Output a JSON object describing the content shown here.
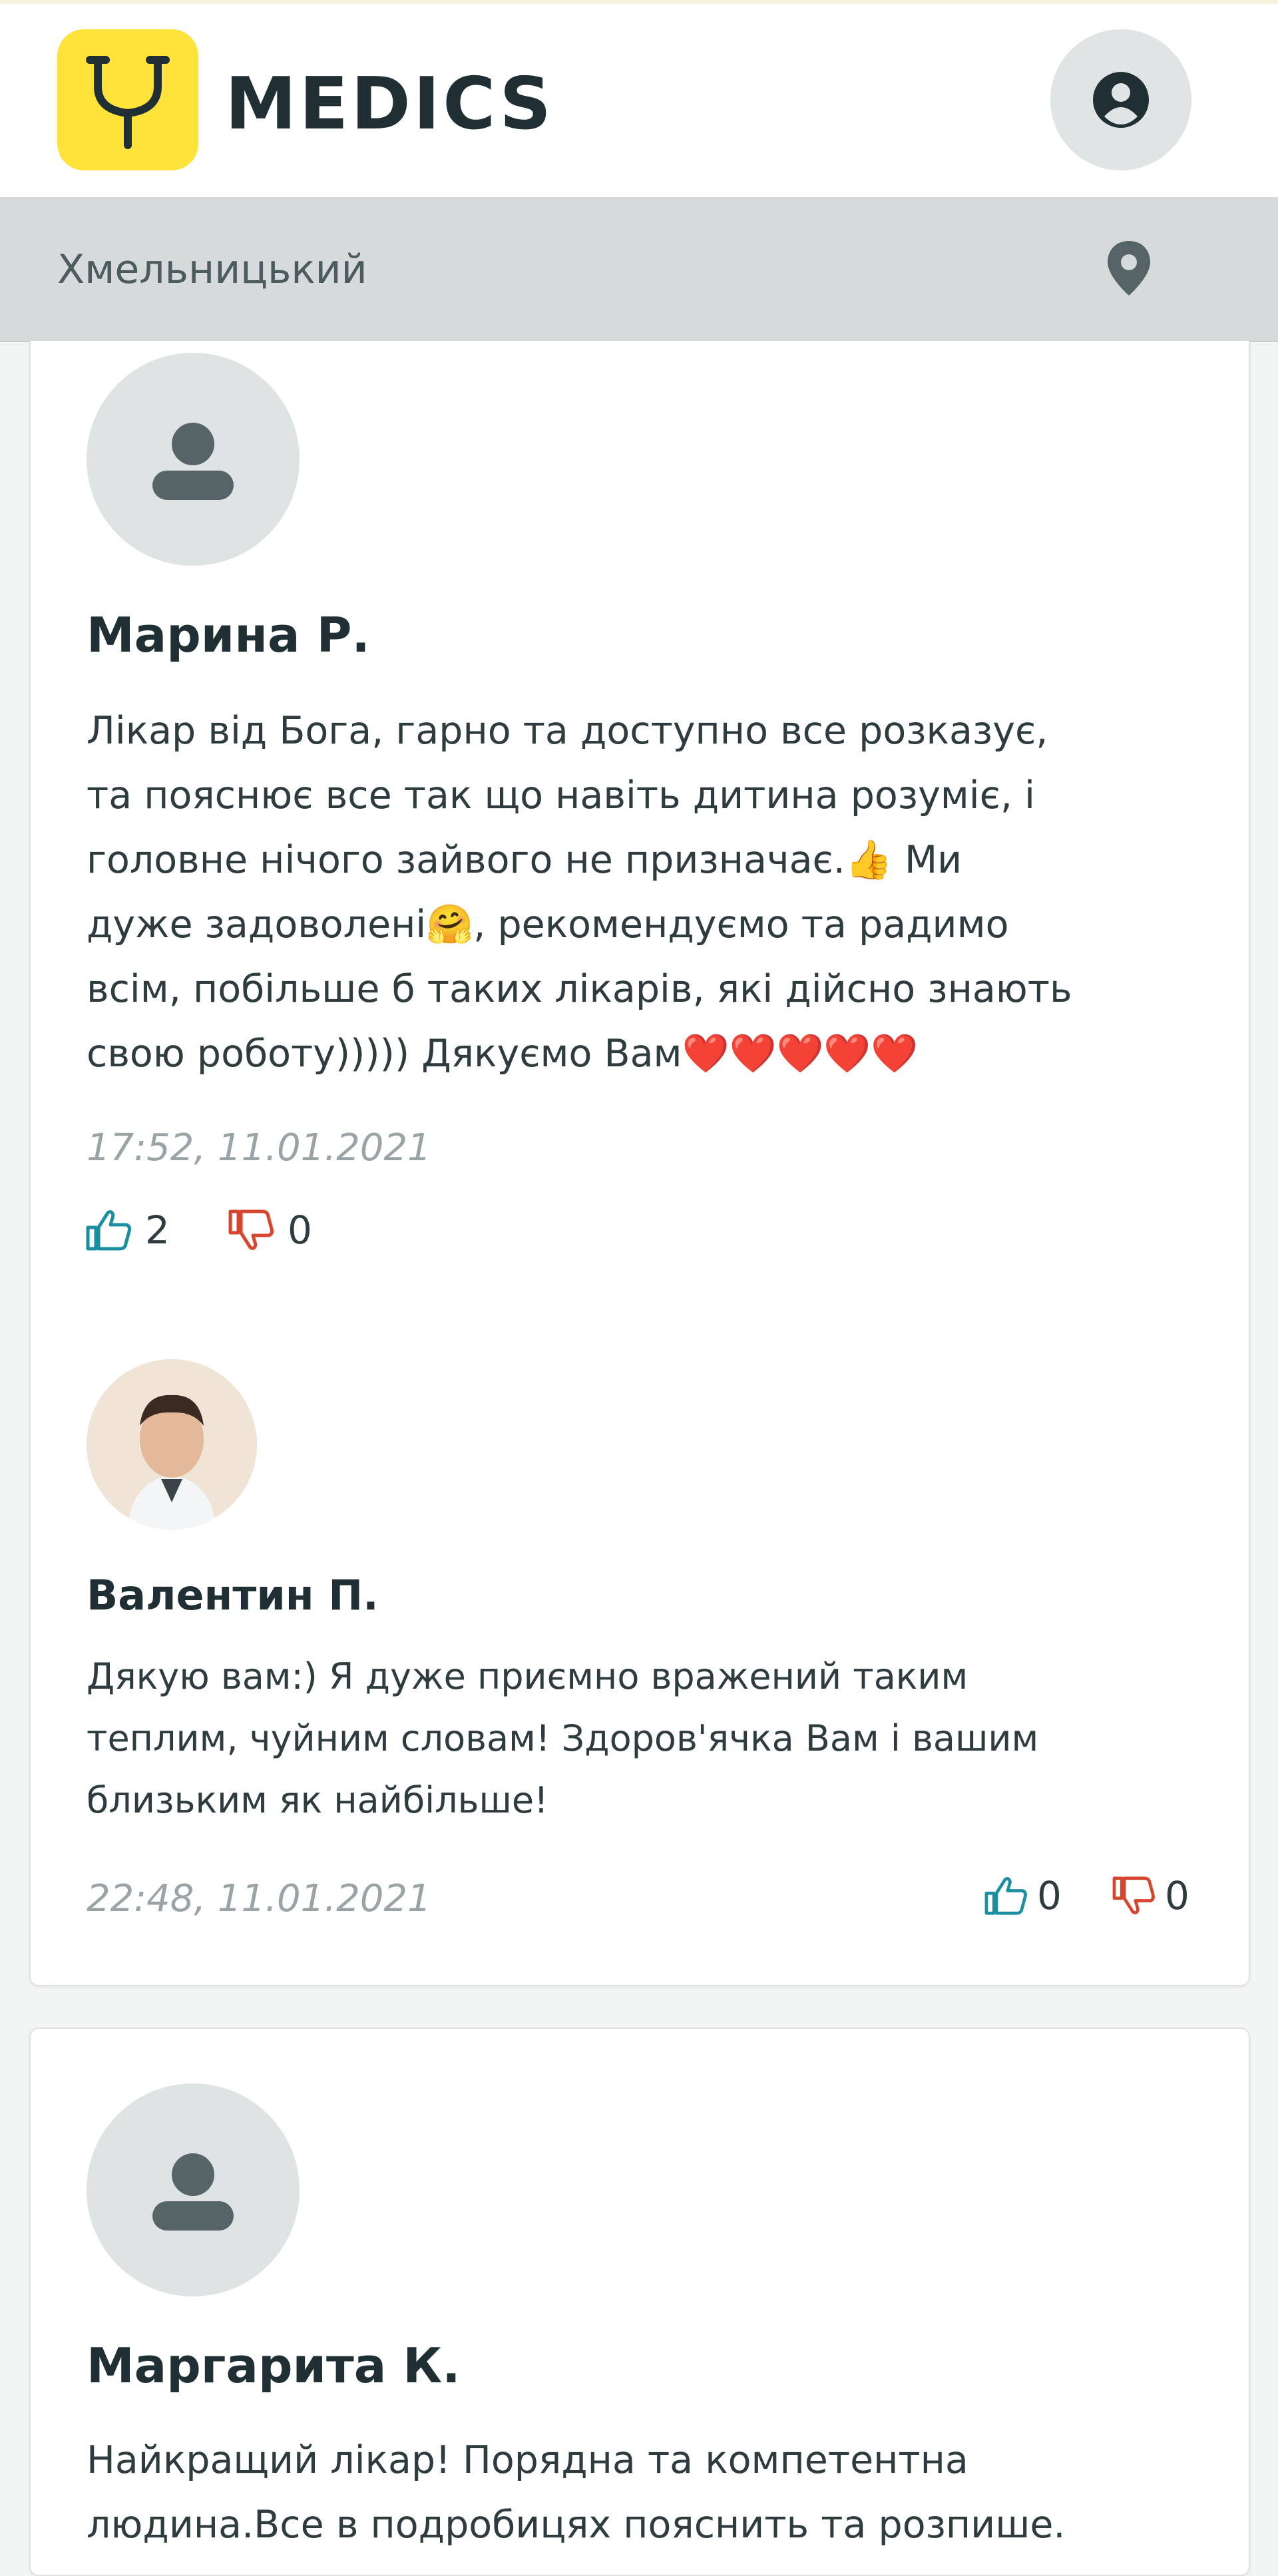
{
  "header": {
    "logo_text": "MEDICS",
    "logo_icon": "stethoscope-icon",
    "profile_icon": "user-circle-icon",
    "brand_color": "#ffe23a"
  },
  "location": {
    "city": "Хмельницький",
    "icon": "map-pin-icon"
  },
  "reviews": [
    {
      "author": "Марина Р.",
      "text": "Лікар від Бога, гарно та доступно все розказує,\nта пояснює все так що навіть дитина розуміє, і\nголовне нічого зайвого не призначає.👍 Ми\nдуже задоволені🤗, рекомендуємо та радимо\nвсім, побільше б таких лікарів, які дійсно знають\nсвою роботу))))) Дякуємо Вам❤️❤️❤️❤️❤️",
      "date": "17:52, 11.01.2021",
      "likes": "2",
      "dislikes": "0",
      "reply": {
        "author": "Валентин П.",
        "text": "Дякую вам:) Я дуже приємно вражений таким\nтеплим, чуйним словам! Здоров'ячка Вам і вашим\nблизьким як найбільше!",
        "date": "22:48, 11.01.2021",
        "likes": "0",
        "dislikes": "0"
      }
    },
    {
      "author": "Маргарита К.",
      "text": "Найкращий лікар! Порядна та компетентна\nлюдина.Все в подробицях пояснить та розпише."
    }
  ],
  "colors": {
    "like": "#1b8fa0",
    "dislike": "#d8452f"
  }
}
